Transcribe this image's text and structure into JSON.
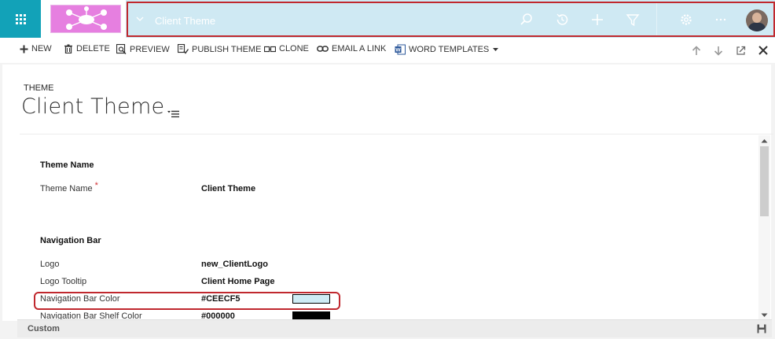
{
  "navbar": {
    "title": "Client Theme",
    "icons": [
      "apps-grid-icon",
      "search-icon",
      "recent-history-icon",
      "plus-icon",
      "filter-icon",
      "gear-icon",
      "more-icon",
      "user-avatar"
    ],
    "colors": {
      "nav": "#CEECF5",
      "app_tile": "#12A2B8",
      "logo": "#E67FE0",
      "highlight": "#C0282E"
    }
  },
  "command_bar": {
    "new": "NEW",
    "delete": "DELETE",
    "preview": "PREVIEW",
    "publish": "PUBLISH THEME",
    "clone": "CLONE",
    "email": "EMAIL A LINK",
    "word": "WORD TEMPLATES"
  },
  "header": {
    "entity": "THEME",
    "title": "Client Theme"
  },
  "form": {
    "theme_section": "Theme Name",
    "theme_name_label": "Theme Name",
    "required_marker": "*",
    "theme_name_value": "Client Theme",
    "nav_section": "Navigation Bar",
    "rows": [
      {
        "label": "Logo",
        "value": "new_ClientLogo"
      },
      {
        "label": "Logo Tooltip",
        "value": "Client Home Page"
      },
      {
        "label": "Navigation Bar Color",
        "value": "#CEECF5",
        "swatch": "#CEECF5"
      },
      {
        "label": "Navigation Bar Shelf Color",
        "value": "#000000",
        "swatch": "#000000"
      }
    ]
  },
  "footer": {
    "status": "Custom"
  }
}
